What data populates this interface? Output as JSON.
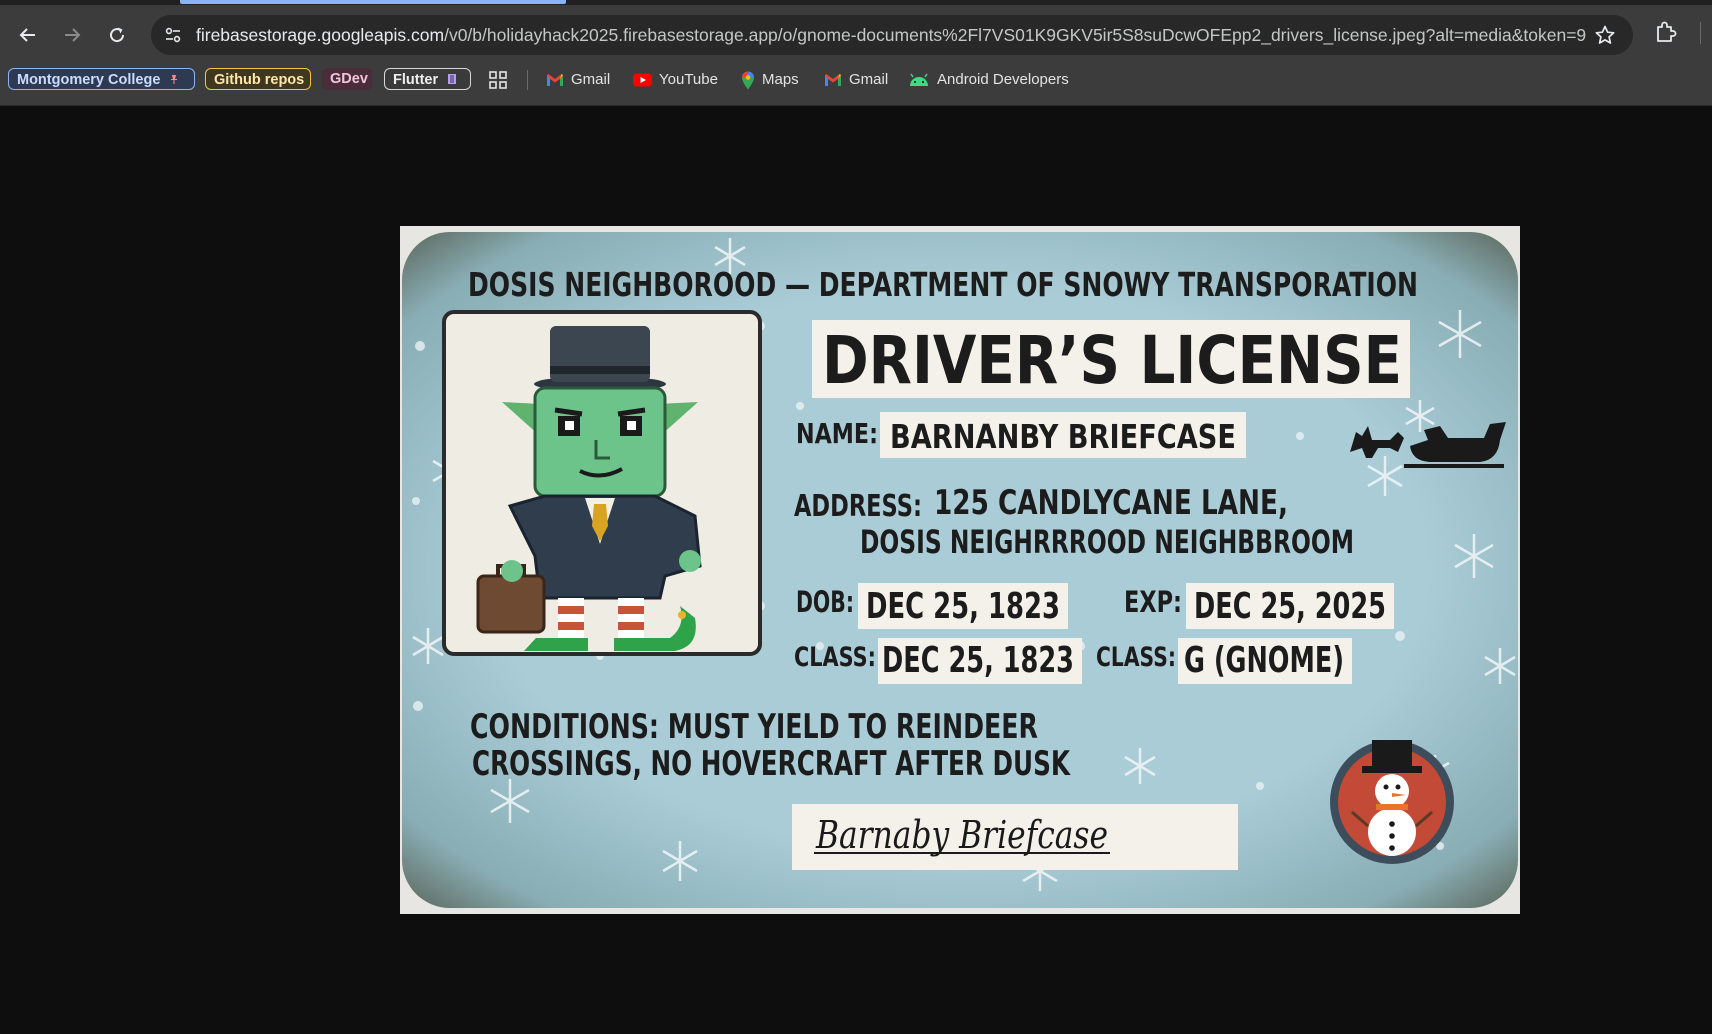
{
  "browser": {
    "url_host": "firebasestorage.googleapis.com",
    "url_path": "/v0/b/holidayhack2025.firebasestorage.app/o/gnome-documents%2Fl7VS01K9GKV5ir5S8suDcwOFEpp2_drivers_license.jpeg?alt=media&token=9...",
    "bookmarks": [
      {
        "label": "Montgomery College",
        "icon": "pin-icon"
      },
      {
        "label": "Github repos"
      },
      {
        "label": "GDev"
      },
      {
        "label": "Flutter",
        "icon": "flutter-icon"
      },
      {
        "label": "Gmail",
        "icon": "gmail-icon"
      },
      {
        "label": "YouTube",
        "icon": "youtube-icon"
      },
      {
        "label": "Maps",
        "icon": "maps-icon"
      },
      {
        "label": "Gmail",
        "icon": "gmail-icon"
      },
      {
        "label": "Android Developers",
        "icon": "android-icon"
      }
    ]
  },
  "license": {
    "department": "DOSIS NEIGHBOROOD — DEPARTMENT OF SNOWY TRANSPORATION",
    "title": "DRIVER’S LICENSE",
    "name_label": "NAME:",
    "name": "BARNANBY BRIEFCASE",
    "address_label": "ADDRESS:",
    "address_line1": "125 CANDLYCANE LANE,",
    "address_line2": "DOSIS NEIGHRRROOD NEIGHBBROOM",
    "dob_label": "DOB:",
    "dob": "DEC 25, 1823",
    "exp_label": "EXP:",
    "exp": "DEC 25, 2025",
    "class_label_1": "CLASS:",
    "class_value_1": "DEC 25, 1823",
    "class_label_2": "CLASS:",
    "class_value_2": "G (GNOME)",
    "conditions_line1": "CONDITIONS:  MUST YIELD TO REINDEER",
    "conditions_line2": "CROSSINGS, NO HOVERCRAFT AFTER DUSK",
    "signature": "Barnaby Briefcase"
  },
  "colors": {
    "card_bg": "#9fc7d3",
    "chrome_bg": "#3c3c3c",
    "page_bg": "#0e0e0e"
  }
}
